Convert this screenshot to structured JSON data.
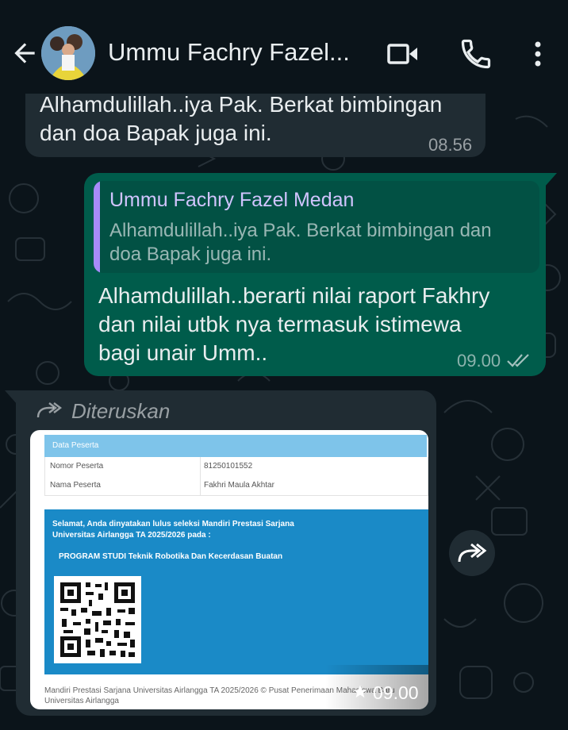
{
  "header": {
    "title": "Ummu Fachry Fazel...",
    "icons": [
      "back-arrow-icon",
      "video-call-icon",
      "voice-call-icon",
      "more-options-icon"
    ]
  },
  "messages": [
    {
      "direction": "incoming",
      "lines": [
        "Alhamdulillah..iya Pak. Berkat bimbingan",
        "dan doa Bapak juga ini."
      ],
      "time": "08.56"
    },
    {
      "direction": "outgoing",
      "quote": {
        "author": "Ummu Fachry Fazel Medan",
        "lines": [
          "Alhamdulillah..iya Pak. Berkat bimbingan dan",
          "doa Bapak juga ini."
        ]
      },
      "lines": [
        "Alhamdulillah..berarti nilai raport Fakhry",
        "dan nilai utbk nya termasuk istimewa",
        "bagi unair Umm.."
      ],
      "time": "09.00",
      "status": "read"
    },
    {
      "direction": "incoming",
      "forwarded_label": "Diteruskan",
      "image": {
        "header": "Data Peserta",
        "rows": [
          {
            "label": "Nomor Peserta",
            "value": "81250101552"
          },
          {
            "label": "Nama Peserta",
            "value": "Fakhri Maula Akhtar"
          }
        ],
        "result_lines": [
          "Selamat, Anda dinyatakan lulus seleksi Mandiri Prestasi Sarjana",
          "Universitas Airlangga TA 2025/2026 pada :"
        ],
        "program": "PROGRAM STUDI  Teknik Robotika Dan Kecerdasan Buatan",
        "footer": "Mandiri Prestasi Sarjana Universitas Airlangga TA 2025/2026 © Pusat Penerimaan Mahasiswa Baru Universitas Airlangga"
      },
      "starred": true,
      "time": "09.00"
    }
  ],
  "colors": {
    "background": "#0b141a",
    "incoming_bubble": "#202c33",
    "outgoing_bubble": "#005c4b",
    "quote_accent": "#a78bfa"
  }
}
